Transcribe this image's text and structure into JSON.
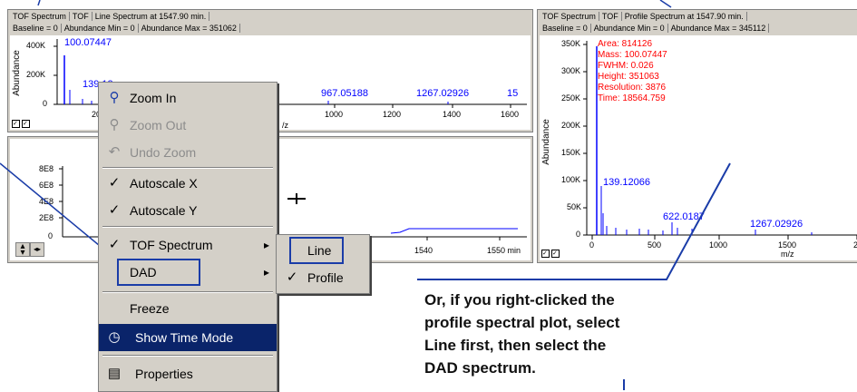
{
  "left_panel": {
    "tabs": [
      "TOF Spectrum",
      "TOF",
      "Line Spectrum at 1547.90 min."
    ],
    "baseline": "Baseline = 0",
    "abund_min": "Abundance Min = 0",
    "abund_max": "Abundance Max = 351062",
    "ylabel": "Abundance",
    "yticks": [
      "400K",
      "200K",
      "0"
    ],
    "xticks": [
      "200",
      "1000",
      "1200",
      "1400",
      "1600"
    ],
    "xlabel": "/z",
    "peaks": [
      "100.07447",
      "139.12",
      "967.05188",
      "1267.02926",
      "15"
    ]
  },
  "chrom_panel": {
    "yticks": [
      "8E8",
      "6E8",
      "4E8",
      "2E8",
      "0"
    ],
    "xticks": [
      "1540",
      "1550 min"
    ]
  },
  "right_panel": {
    "tabs": [
      "TOF Spectrum",
      "TOF",
      "Profile Spectrum at 1547.90 min."
    ],
    "baseline": "Baseline = 0",
    "abund_min": "Abundance Min = 0",
    "abund_max": "Abundance Max = 345112",
    "ylabel": "Abundance",
    "yticks": [
      "350K",
      "300K",
      "250K",
      "200K",
      "150K",
      "100K",
      "50K",
      "0"
    ],
    "xticks": [
      "0",
      "500",
      "1000",
      "1500",
      "2"
    ],
    "xlabel": "m/z",
    "info": [
      "Area: 814126",
      "Mass: 100.07447",
      "FWHM: 0.026",
      "Height: 351063",
      "Resolution: 3876",
      "Time: 18564.759"
    ],
    "peaks": [
      "139.12066",
      "622.0187",
      "1267.02926"
    ]
  },
  "context_menu": {
    "zoom_in": "Zoom In",
    "zoom_out": "Zoom Out",
    "undo_zoom": "Undo Zoom",
    "autoscale_x": "Autoscale X",
    "autoscale_y": "Autoscale Y",
    "tof_spectrum": "TOF Spectrum",
    "dad": "DAD",
    "freeze": "Freeze",
    "show_time_mode": "Show Time Mode",
    "properties": "Properties",
    "check": "✓",
    "arrow": "▸"
  },
  "submenu": {
    "line": "Line",
    "profile": "Profile"
  },
  "caption": {
    "lines": [
      "Or, if you right-clicked the",
      "profile spectral plot, select",
      "Line first, then select the",
      "DAD spectrum."
    ]
  },
  "colors": {
    "accent": "#1a3ca8",
    "peak": "#0000ff",
    "info": "#ff0000",
    "menu_bg": "#d4d0c8",
    "highlight": "#0a246a"
  }
}
